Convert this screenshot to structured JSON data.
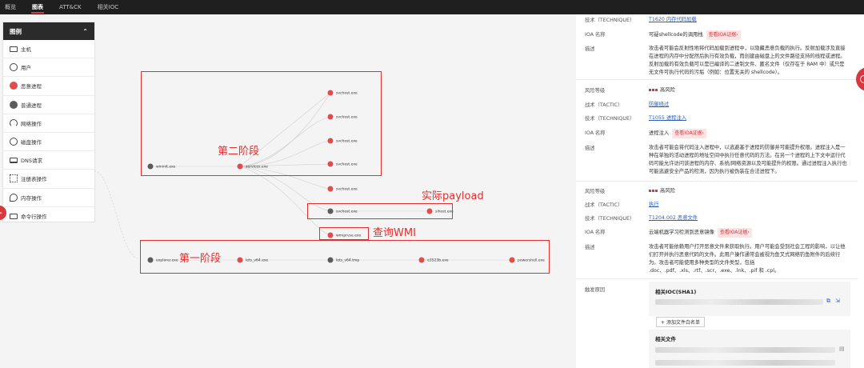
{
  "tabs": [
    "概览",
    "图表",
    "ATT&CK",
    "相关IOC"
  ],
  "legend": {
    "title": "图例",
    "items": [
      {
        "icon": "host-icon",
        "label": "主机"
      },
      {
        "icon": "user-icon",
        "label": "用户"
      },
      {
        "icon": "malicious-process-icon",
        "label": "恶意进程"
      },
      {
        "icon": "normal-process-icon",
        "label": "普通进程"
      },
      {
        "icon": "network-icon",
        "label": "网络操作"
      },
      {
        "icon": "disk-icon",
        "label": "磁盘操作"
      },
      {
        "icon": "dns-icon",
        "label": "DNS请求"
      },
      {
        "icon": "registry-icon",
        "label": "注册表操作"
      },
      {
        "icon": "memory-icon",
        "label": "内存操作"
      },
      {
        "icon": "command-icon",
        "label": "命令行操作"
      }
    ]
  },
  "graph": {
    "nodes": {
      "wininit": {
        "label": "wininit.exe",
        "kind": "normal"
      },
      "services": {
        "label": "services.exe",
        "kind": "evil"
      },
      "svchost1": {
        "label": "svchost.exe",
        "kind": "evil"
      },
      "svchost2": {
        "label": "svchost.exe",
        "kind": "evil"
      },
      "svchost3": {
        "label": "svchost.exe",
        "kind": "evil"
      },
      "svchost4": {
        "label": "svchost.exe",
        "kind": "evil"
      },
      "svchost5": {
        "label": "svchost.exe",
        "kind": "evil"
      },
      "svchost6": {
        "label": "svchost.exe",
        "kind": "normal"
      },
      "sihost": {
        "label": "sihost.exe",
        "kind": "evil"
      },
      "wmiprvse": {
        "label": "wmiprvse.exe",
        "kind": "evil"
      },
      "explorer": {
        "label": "explorer.exe",
        "kind": "normal"
      },
      "lets1": {
        "label": "lets_v64.exe",
        "kind": "evil"
      },
      "lets2": {
        "label": "lets_v64.tmp",
        "kind": "normal"
      },
      "e3523b": {
        "label": "e3523b.exe",
        "kind": "evil"
      },
      "powershell": {
        "label": "powershell.exe",
        "kind": "evil"
      }
    },
    "annotations": {
      "stage2": "第二阶段",
      "payload": "实际payload",
      "wmi": "查询WMI",
      "stage1": "第一阶段"
    }
  },
  "detail": {
    "block1": {
      "technique_key": "技术（TECHNIQUE）",
      "technique_val": "T1620 内存代码加载",
      "ioa_key": "IOA 名称",
      "ioa_val": "可疑shellcode的调用栈",
      "ioa_badge": "查看IOA证据›",
      "desc_key": "描述",
      "desc_val": "攻击者可能会反射性地将代码加载到进程中，以隐藏恶意负载的执行。反射加载涉及直接在进程的内存中分配然后执行有效负载，而创建由磁盘上的文件路径支持的线程或进程。反射加载的有效负载可以是已编译的二进制文件、匿名文件（仅存在于 RAM 中）或只是无文件可执行代码的污垢（例如：位置无关的 shellcode）。"
    },
    "block2": {
      "risk_key": "风险等级",
      "risk_val": "高风险",
      "tactic_key": "战术（TACTIC）",
      "tactic_val": "防御绕过",
      "technique_key": "技术（TECHNIQUE）",
      "technique_val": "T1055 进程注入",
      "ioa_key": "IOA 名称",
      "ioa_val": "进程注入",
      "ioa_badge": "查看IOA证据›",
      "desc_key": "描述",
      "desc_val": "攻击者可能会将代码注入进程中，以逃避基于进程的防御并可能提升权限。进程注入是一种在单独的活动进程的地址空间中执行任意代码的方法。在另一个进程的上下文中运行代码可能允许访问该进程的内存、系统/网络资源以及可能提升的权限。通过进程注入执行也可能逃避安全产品的检测，因为执行被伪装在合法进程下。"
    },
    "block3": {
      "risk_key": "风险等级",
      "risk_val": "高风险",
      "tactic_key": "战术（TACTIC）",
      "tactic_val": "执行",
      "technique_key": "技术（TECHNIQUE）",
      "technique_val": "T1204.002 恶意文件",
      "ioa_key": "IOA 名称",
      "ioa_val": "云端机器学习检测到恶意镜像",
      "ioa_badge": "查看IOA证据›",
      "desc_key": "描述",
      "desc_val": "攻击者可能依赖用户打开恶意文件来获取执行。用户可能会受到社会工程的影响，以让他们打开并执行恶意代码的文件。此用户操作通常会被视为鱼叉式网络钓鱼附件的后续行为。攻击者可能使用多种类型的文件类型，包括 .doc、.pdf、.xls、.rtf、.scr、.exe、.lnk、.pif 和 .cpl。"
    },
    "trigger_key": "触发原因",
    "ioc_title": "相关IOC(SHA1)",
    "add_whitelist": "+ 添加文件白名单",
    "files_title": "相关文件"
  },
  "colors": {
    "accent": "#d9363e",
    "evil_node": "#e04d4d",
    "normal_node": "#5c5c5c",
    "annotation": "#e03030"
  }
}
